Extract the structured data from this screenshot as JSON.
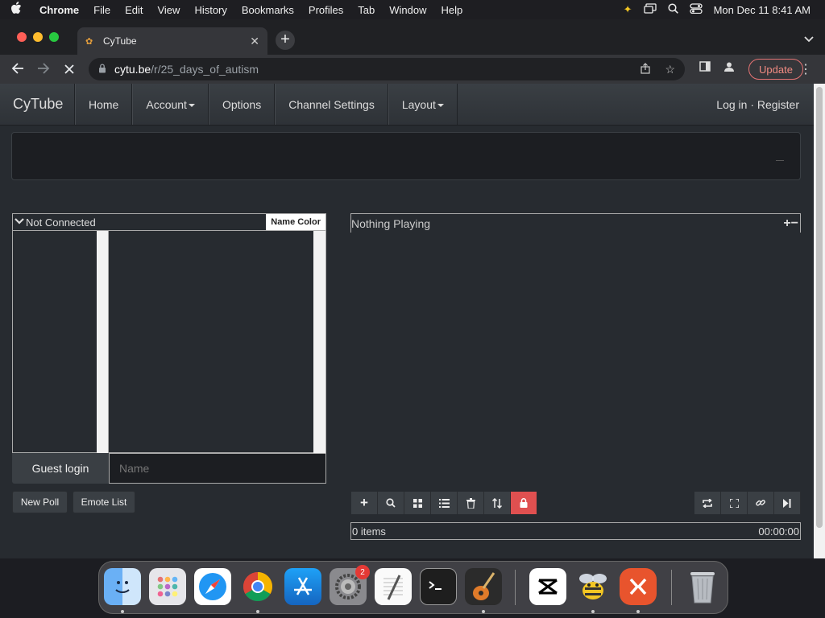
{
  "menubar": {
    "app": "Chrome",
    "items": [
      "File",
      "Edit",
      "View",
      "History",
      "Bookmarks",
      "Profiles",
      "Tab",
      "Window",
      "Help"
    ],
    "datetime": "Mon Dec 11  8:41 AM"
  },
  "browser": {
    "tab_title": "CyTube",
    "url_host": "cytu.be",
    "url_path": "/r/25_days_of_autism",
    "update_label": "Update"
  },
  "cytube": {
    "brand": "CyTube",
    "nav": {
      "home": "Home",
      "account": "Account",
      "options": "Options",
      "channel_settings": "Channel Settings",
      "layout": "Layout"
    },
    "login_text": "Log in · Register",
    "chat": {
      "status": "Not Connected",
      "name_color": "Name Color",
      "guest_login": "Guest login",
      "name_placeholder": "Name",
      "new_poll": "New Poll",
      "emote_list": "Emote List"
    },
    "player": {
      "now_playing": "Nothing Playing",
      "plus_minus": "+−"
    },
    "playlist": {
      "item_count": "0 items",
      "duration": "00:00:00",
      "buttons": [
        "+",
        "⌕",
        "▦",
        "☰",
        "🗑",
        "⇅",
        "🔒"
      ],
      "right_buttons": [
        "⟲",
        "⛶",
        "🔗",
        "⏭"
      ]
    }
  },
  "dock": {
    "settings_badge": "2",
    "apps": [
      "Finder",
      "Launchpad",
      "Safari",
      "Chrome",
      "App Store",
      "System Settings",
      "TextEdit",
      "Terminal",
      "GarageBand",
      "CapCut",
      "Cyberduck",
      "Remote Desktop",
      "Trash"
    ]
  },
  "colors": {
    "page_bg": "#272b30",
    "navbar_bg": "#3a3f44",
    "lock_button": "#e05050"
  }
}
